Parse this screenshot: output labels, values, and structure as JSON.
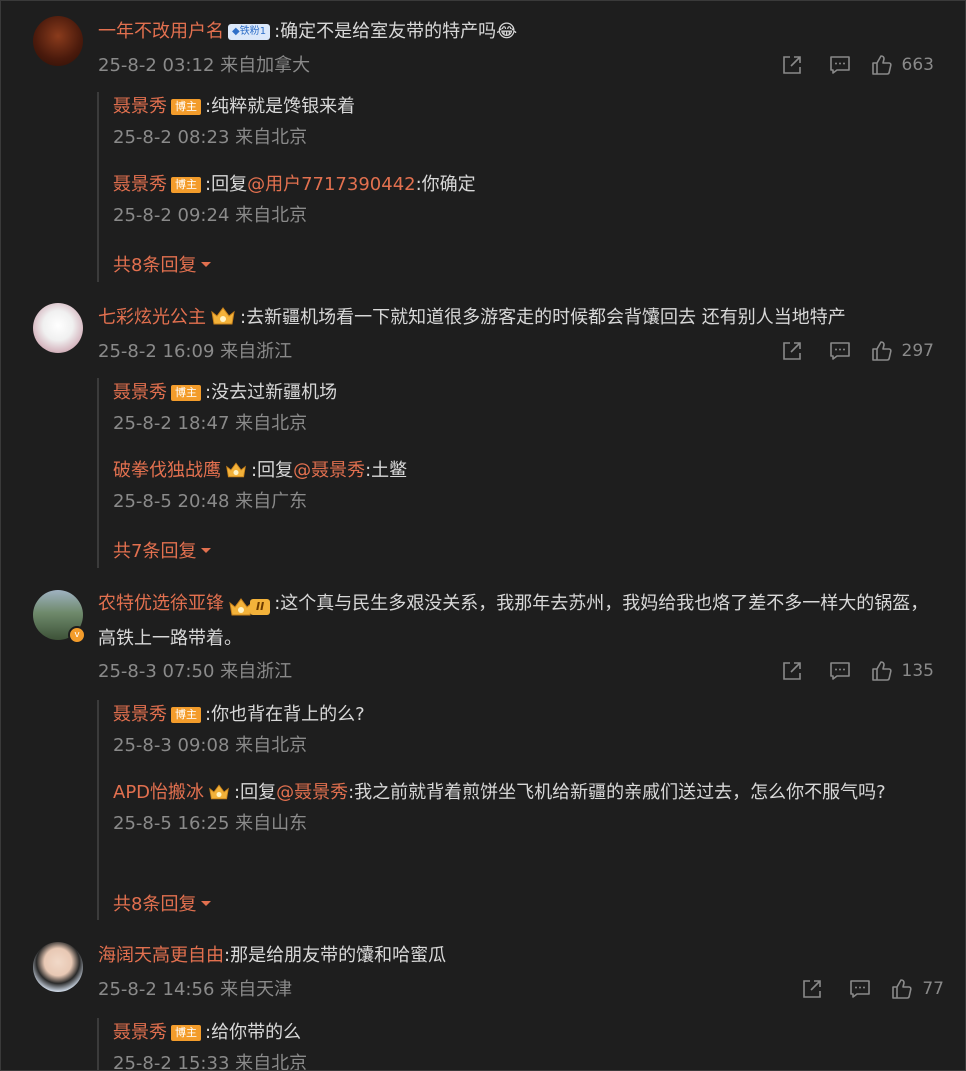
{
  "colors": {
    "background": "#1e1e1e",
    "username": "#e2704f",
    "meta": "#8a8a8a",
    "text": "#d8d8d8",
    "bozhu_badge": "#f39c2b"
  },
  "icons": {
    "share": "share-icon",
    "comment": "comment-icon",
    "like": "thumbs-up-icon",
    "expand": "caret-down-icon",
    "laugh": "laughing-emoji-icon"
  },
  "comments": [
    {
      "username": "一年不改用户名",
      "fan_badge": "铁粉1",
      "text": ":确定不是给室友带的特产吗",
      "time": "25-8-2 03:12",
      "location": "来自加拿大",
      "likes": "663",
      "replies": [
        {
          "username": "聂景秀",
          "badge": "博主",
          "text": ":纯粹就是馋银来着",
          "time": "25-8-2 08:23",
          "location": "来自北京"
        },
        {
          "username": "聂景秀",
          "badge": "博主",
          "prefix": ":回复",
          "mention": "@用户7717390442",
          "text": ":你确定",
          "time": "25-8-2 09:24",
          "location": "来自北京"
        }
      ],
      "more": "共8条回复"
    },
    {
      "username": "七彩炫光公主",
      "text": ":去新疆机场看一下就知道很多游客走的时候都会背馕回去 还有别人当地特产",
      "time": "25-8-2 16:09",
      "location": "来自浙江",
      "likes": "297",
      "replies": [
        {
          "username": "聂景秀",
          "badge": "博主",
          "text": ":没去过新疆机场",
          "time": "25-8-2 18:47",
          "location": "来自北京"
        },
        {
          "username": "破拳伐独战鹰",
          "prefix": ":回复",
          "mention": "@聂景秀",
          "text": ":土鳖",
          "time": "25-8-5 20:48",
          "location": "来自广东"
        }
      ],
      "more": "共7条回复"
    },
    {
      "username": "农特优选徐亚锋",
      "level": "II",
      "text": ":这个真与民生多艰没关系，我那年去苏州，我妈给我也烙了差不多一样大的锅盔，高铁上一路带着。",
      "time": "25-8-3 07:50",
      "location": "来自浙江",
      "likes": "135",
      "replies": [
        {
          "username": "聂景秀",
          "badge": "博主",
          "text": ":你也背在背上的么?",
          "time": "25-8-3 09:08",
          "location": "来自北京"
        },
        {
          "username": "APD怡搬冰",
          "prefix": ":回复",
          "mention": "@聂景秀",
          "text": ":我之前就背着煎饼坐飞机给新疆的亲戚们送过去，怎么你不服气吗?",
          "time": "25-8-5 16:25",
          "location": "来自山东"
        }
      ],
      "more": "共8条回复"
    },
    {
      "username": "海阔天高更自由",
      "text": ":那是给朋友带的馕和哈蜜瓜",
      "time": "25-8-2 14:56",
      "location": "来自天津",
      "likes": "77",
      "replies": [
        {
          "username": "聂景秀",
          "badge": "博主",
          "text": ":给你带的么",
          "time": "25-8-2 15:33",
          "location": "来自北京"
        }
      ]
    }
  ]
}
